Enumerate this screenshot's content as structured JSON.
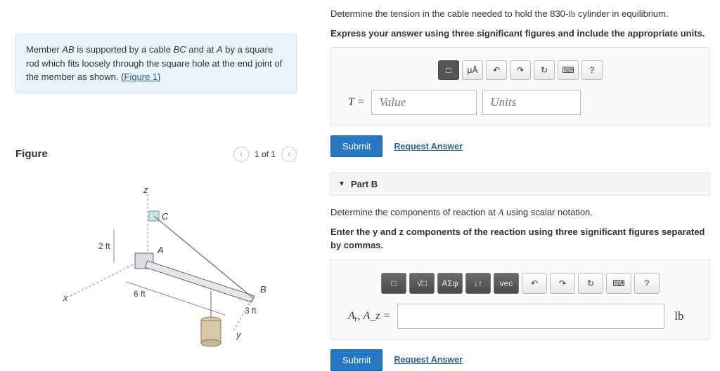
{
  "intro": {
    "text_a": "Member ",
    "var_ab": "AB",
    "text_b": " is supported by a cable ",
    "var_bc": "BC",
    "text_c": " and at ",
    "var_a": "A",
    "text_d": " by a square rod which fits loosely through the square hole at the end joint of the member as shown. (",
    "link": "Figure 1",
    "text_e": ")"
  },
  "figure": {
    "title": "Figure",
    "pager": "1 of 1",
    "labels": {
      "z": "z",
      "C": "C",
      "two_ft": "2 ft",
      "A": "A",
      "x": "x",
      "six_ft": "6 ft",
      "B": "B",
      "three_ft": "3 ft",
      "y": "y"
    }
  },
  "partA": {
    "q1a": "Determine the tension in the cable needed to hold the 830-",
    "q1unit": "lb",
    "q1b": " cylinder in equilibrium.",
    "q2": "Express your answer using three significant figures and include the appropriate units.",
    "toolbar": {
      "tpl": "□",
      "mua": "μÅ",
      "undo": "↶",
      "redo": "↷",
      "reset": "↻",
      "kbd": "⌨",
      "help": "?"
    },
    "eq_label": "T =",
    "value_ph": "Value",
    "units_ph": "Units",
    "submit": "Submit",
    "request": "Request Answer"
  },
  "partB": {
    "header": "Part B",
    "q1a": "Determine the components of reaction at ",
    "q1var": "A",
    "q1b": " using scalar notation.",
    "q2": "Enter the y and z components of the reaction using three significant figures separated by commas.",
    "toolbar": {
      "tpl": "□",
      "sqrt": "√□",
      "greek": "ΑΣφ",
      "arrows": "↓↑",
      "vec": "vec",
      "undo": "↶",
      "redo": "↷",
      "reset": "↻",
      "kbd": "⌨",
      "help": "?"
    },
    "eq_label": "Aᵧ, A_z =",
    "unit_suffix": "lb",
    "submit": "Submit",
    "request": "Request Answer"
  }
}
